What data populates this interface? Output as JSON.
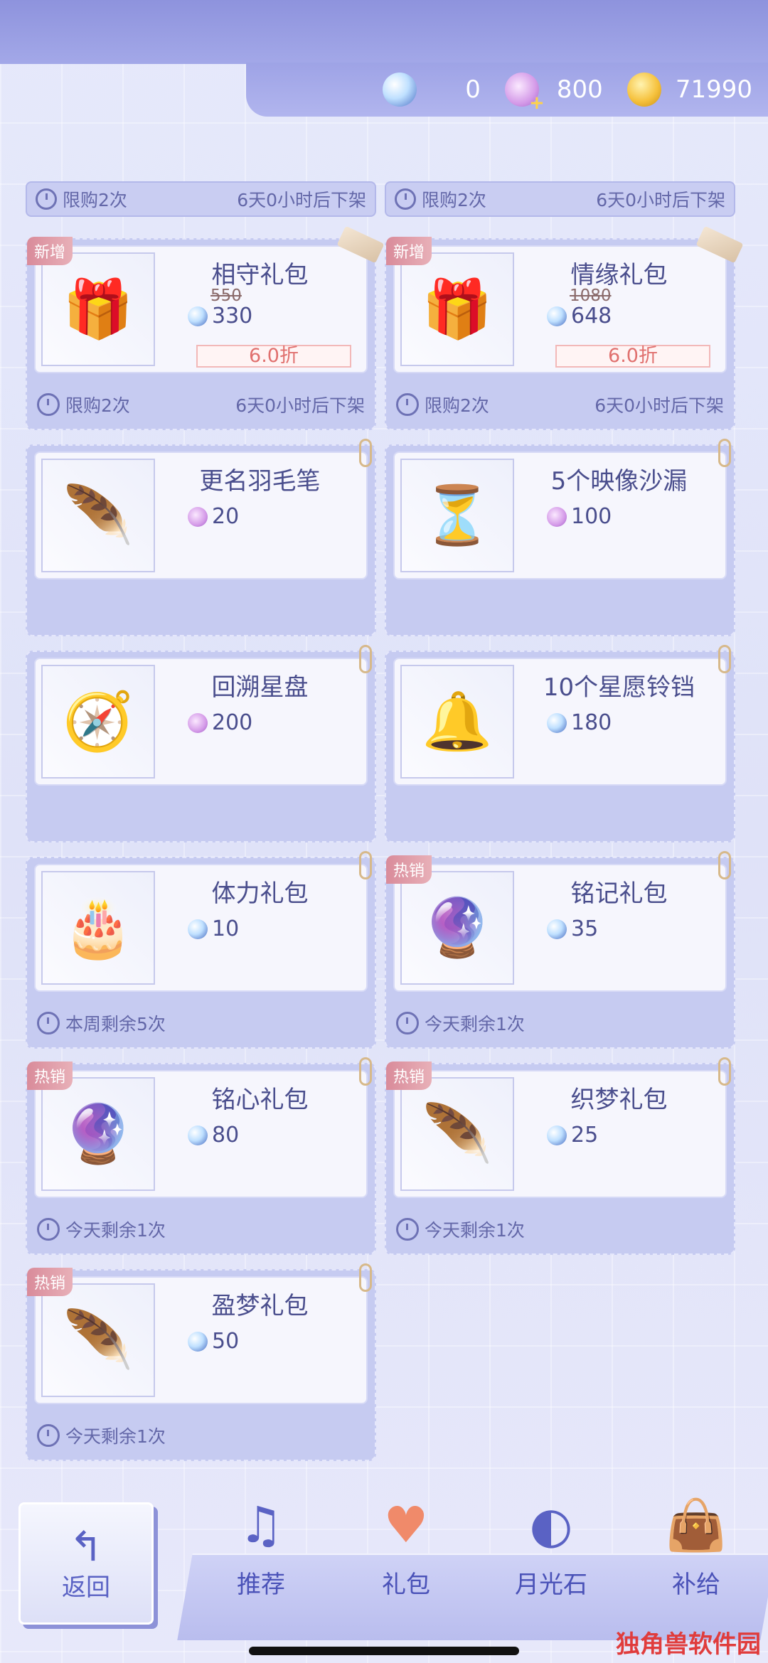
{
  "currencies": [
    {
      "icon": "moonstone-icon",
      "value": "0"
    },
    {
      "icon": "swan-plus-icon",
      "value": "800"
    },
    {
      "icon": "gold-coin-icon",
      "value": "71990"
    }
  ],
  "top_strips": [
    {
      "left": "限购2次",
      "right": "6天0小时后下架"
    },
    {
      "left": "限购2次",
      "right": "6天0小时后下架"
    }
  ],
  "items": [
    {
      "badge": "新增",
      "name": "相守礼包",
      "old_price": "550",
      "price": "330",
      "currency": "moonstone",
      "discount": "6.0折",
      "left": "限购2次",
      "right": "6天0小时后下架",
      "image": "🎁",
      "deco": "ribbon"
    },
    {
      "badge": "新增",
      "name": "情缘礼包",
      "old_price": "1080",
      "price": "648",
      "currency": "moonstone",
      "discount": "6.0折",
      "left": "限购2次",
      "right": "6天0小时后下架",
      "image": "🎁",
      "deco": "ribbon"
    },
    {
      "badge": "",
      "name": "更名羽毛笔",
      "old_price": "",
      "price": "20",
      "currency": "swan",
      "discount": "",
      "left": "",
      "right": "",
      "image": "🪶",
      "deco": "clip"
    },
    {
      "badge": "",
      "name": "5个映像沙漏",
      "old_price": "",
      "price": "100",
      "currency": "swan",
      "discount": "",
      "left": "",
      "right": "",
      "image": "⏳",
      "deco": "clip"
    },
    {
      "badge": "",
      "name": "回溯星盘",
      "old_price": "",
      "price": "200",
      "currency": "swan",
      "discount": "",
      "left": "",
      "right": "",
      "image": "🧭",
      "deco": "clip"
    },
    {
      "badge": "",
      "name": "10个星愿铃铛",
      "old_price": "",
      "price": "180",
      "currency": "moonstone",
      "discount": "",
      "left": "",
      "right": "",
      "image": "🔔",
      "deco": "clip"
    },
    {
      "badge": "",
      "name": "体力礼包",
      "old_price": "",
      "price": "10",
      "currency": "moonstone",
      "discount": "",
      "left": "本周剩余5次",
      "right": "",
      "image": "🎂",
      "deco": "clip"
    },
    {
      "badge": "热销",
      "name": "铭记礼包",
      "old_price": "",
      "price": "35",
      "currency": "moonstone",
      "discount": "",
      "left": "今天剩余1次",
      "right": "",
      "image": "🔮",
      "deco": "clip"
    },
    {
      "badge": "热销",
      "name": "铭心礼包",
      "old_price": "",
      "price": "80",
      "currency": "moonstone",
      "discount": "",
      "left": "今天剩余1次",
      "right": "",
      "image": "🔮",
      "deco": "clip"
    },
    {
      "badge": "热销",
      "name": "织梦礼包",
      "old_price": "",
      "price": "25",
      "currency": "moonstone",
      "discount": "",
      "left": "今天剩余1次",
      "right": "",
      "image": "🪶",
      "deco": "clip"
    },
    {
      "badge": "热销",
      "name": "盈梦礼包",
      "old_price": "",
      "price": "50",
      "currency": "moonstone",
      "discount": "",
      "left": "今天剩余1次",
      "right": "",
      "image": "🪶",
      "deco": "clip"
    }
  ],
  "nav": {
    "back_label": "返回",
    "tabs": [
      {
        "label": "推荐",
        "icon": "swan-icon"
      },
      {
        "label": "礼包",
        "icon": "gift-heart-icon",
        "active": true
      },
      {
        "label": "月光石",
        "icon": "moonstone-orb-icon"
      },
      {
        "label": "补给",
        "icon": "shopping-bag-icon"
      }
    ]
  },
  "watermark": "独角兽软件园"
}
